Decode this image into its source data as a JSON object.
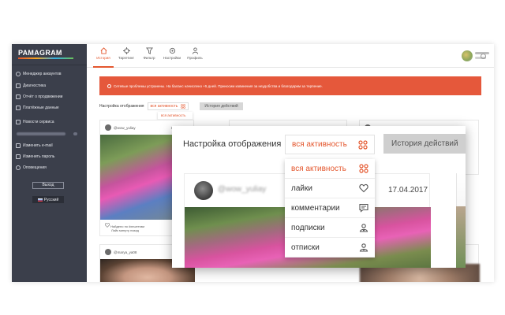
{
  "sidebar": {
    "logo": "PAMAGRAM",
    "items": [
      {
        "label": "Менеджер аккаунтов",
        "icon": "users-icon"
      },
      {
        "label": "Диагностика",
        "icon": "diagnostics-icon"
      },
      {
        "label": "Отчёт о продвижении",
        "icon": "report-icon"
      },
      {
        "label": "Платёжные данные",
        "icon": "card-icon"
      },
      {
        "label": "Новости сервиса",
        "icon": "news-icon"
      }
    ],
    "account_items": [
      {
        "label": "Изменить e-mail",
        "icon": "email-icon"
      },
      {
        "label": "Изменить пароль",
        "icon": "lock-icon"
      },
      {
        "label": "Оповещения",
        "icon": "bell-icon"
      }
    ],
    "logout_label": "Выход",
    "language_label": "Русский"
  },
  "topnav": {
    "items": [
      {
        "label": "История",
        "icon": "home-icon",
        "active": true
      },
      {
        "label": "Таргетинг",
        "icon": "target-icon",
        "active": false
      },
      {
        "label": "Фильтр",
        "icon": "filter-icon",
        "active": false
      },
      {
        "label": "Настройки",
        "icon": "gear-icon",
        "active": false
      },
      {
        "label": "Профиль",
        "icon": "profile-icon",
        "active": false
      }
    ]
  },
  "alert": {
    "text": "Сетевые проблемы устранены. На баланс начислено +5 дней. Приносим извинения за неудобства и благодарим за терпение."
  },
  "filter": {
    "label": "Настройка отображения",
    "selected": "вся активность",
    "history_button": "История действий",
    "options": [
      "вся активность",
      "лайки",
      "комментарии",
      "подписки",
      "отписки"
    ]
  },
  "feed_cards": [
    {
      "username": "@wow_yuliay",
      "date": "17.04.2017",
      "footer_line1": "Найдено по #хештегам",
      "footer_line2": "Лайк минуту назад"
    },
    {
      "username": "@marya_ya08",
      "date": ""
    }
  ],
  "zoom": {
    "username": "@wow_yuliay",
    "date": "17.04.2017"
  },
  "colors": {
    "accent": "#e4572e",
    "sidebar_bg": "#3b3f4b",
    "alert_bg": "#e5583b"
  }
}
